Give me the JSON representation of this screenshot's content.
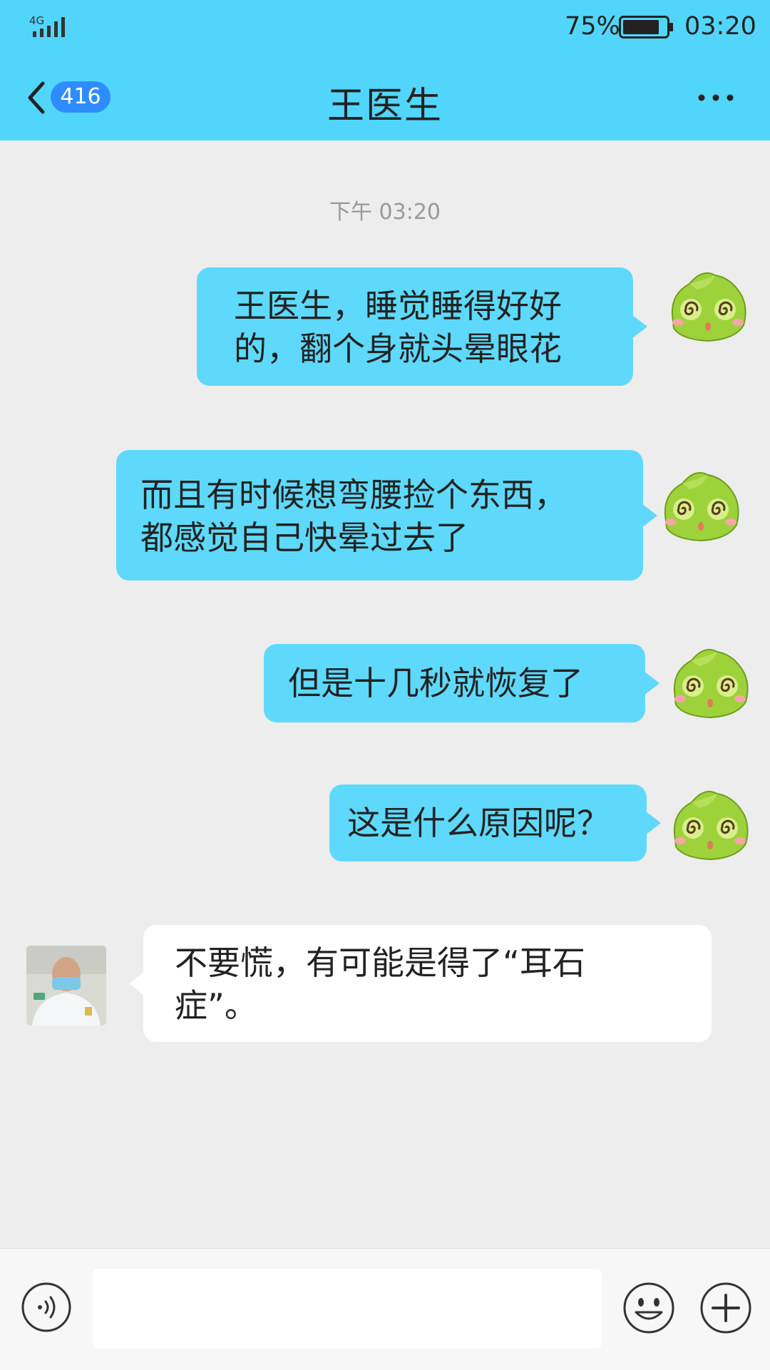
{
  "status_bar": {
    "network": "4G",
    "battery_percent": "75%",
    "time": "03:20"
  },
  "nav": {
    "back_icon": "chevron-left-icon",
    "unread_count": "416",
    "title": "王医生",
    "more_icon": "more-dots-icon"
  },
  "chat": {
    "timestamp": "下午 03:20",
    "messages": [
      {
        "side": "right",
        "lines": [
          "王医生，睡觉睡得好好",
          "的，翻个身就头晕眼花"
        ]
      },
      {
        "side": "right",
        "lines": [
          "而且有时候想弯腰捡个东西，",
          "都感觉自己快晕过去了"
        ]
      },
      {
        "side": "right",
        "lines": [
          "但是十几秒就恢复了"
        ]
      },
      {
        "side": "right",
        "lines": [
          "这是什么原因呢？"
        ]
      },
      {
        "side": "left",
        "lines": [
          "不要慌，有可能是得了“耳石",
          "症”。"
        ]
      }
    ]
  },
  "input_bar": {
    "voice_icon": "voice-icon",
    "text_value": "",
    "emoji_icon": "emoji-icon",
    "plus_icon": "plus-icon"
  },
  "colors": {
    "header": "#52d5fb",
    "outgoing_bubble": "#5ed9fb",
    "incoming_bubble": "#ffffff",
    "badge": "#2f8cff",
    "background": "#ededed"
  }
}
